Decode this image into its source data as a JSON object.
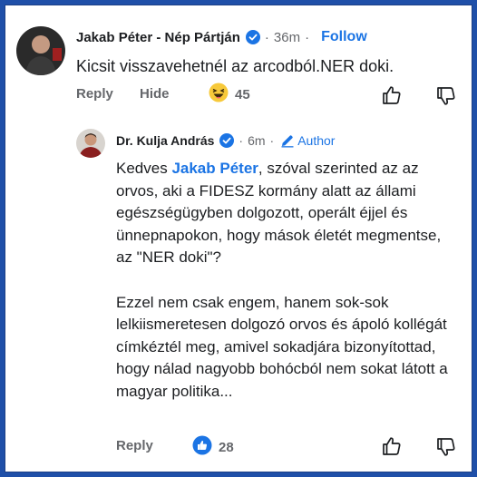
{
  "comment": {
    "author": "Jakab Péter - Nép Pártján",
    "time": "36m",
    "follow_label": "Follow",
    "text": "Kicsit visszavehetnél az arcodból.NER doki.",
    "reply_label": "Reply",
    "hide_label": "Hide",
    "reaction": "haha-icon",
    "reaction_count": "45"
  },
  "reply": {
    "author": "Dr. Kulja András",
    "time": "6m",
    "author_badge": "Author",
    "greeting": "Kedves ",
    "mention": "Jakab Péter",
    "paragraph1_rest": ", szóval szerinted az az orvos, aki a FIDESZ kormány alatt az állami egészségügyben dolgozott, operált éjjel és ünnepnapokon, hogy mások életét megmentse, az \"NER doki\"?",
    "paragraph2": "Ezzel nem csak engem, hanem sok-sok lelkiismeretesen dolgozó orvos és ápoló kollégát címkéztél meg, amivel sokadjára bizonyítottad, hogy nálad nagyobb bohócból nem sokat látott a magyar politika...",
    "reply_label": "Reply",
    "reaction": "like-icon",
    "reaction_count": "28"
  },
  "colors": {
    "frame": "#1f4fa8",
    "accent": "#1b74e4",
    "muted": "#65676b",
    "text": "#1c1e21"
  }
}
